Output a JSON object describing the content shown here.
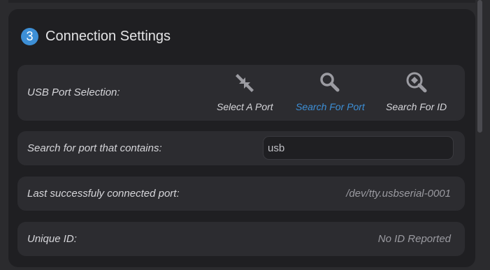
{
  "section": {
    "step_number": "3",
    "title": "Connection Settings"
  },
  "usb_port_selection": {
    "label": "USB Port Selection:",
    "options": [
      {
        "label": "Select A Port",
        "icon": "collapse-arrows-icon",
        "active": false
      },
      {
        "label": "Search For Port",
        "icon": "magnifier-icon",
        "active": true
      },
      {
        "label": "Search For ID",
        "icon": "magnifier-target-icon",
        "active": false
      }
    ]
  },
  "port_search": {
    "label": "Search for port that contains:",
    "value": "usb"
  },
  "last_connected": {
    "label": "Last successfuly connected port:",
    "value": "/dev/tty.usbserial-0001"
  },
  "unique_id": {
    "label": "Unique ID:",
    "value": "No ID Reported"
  },
  "colors": {
    "accent": "#3d8fd6",
    "panel_background": "#1f1f22",
    "row_background": "#2c2c30",
    "icon_gray": "#9c9ca2"
  }
}
